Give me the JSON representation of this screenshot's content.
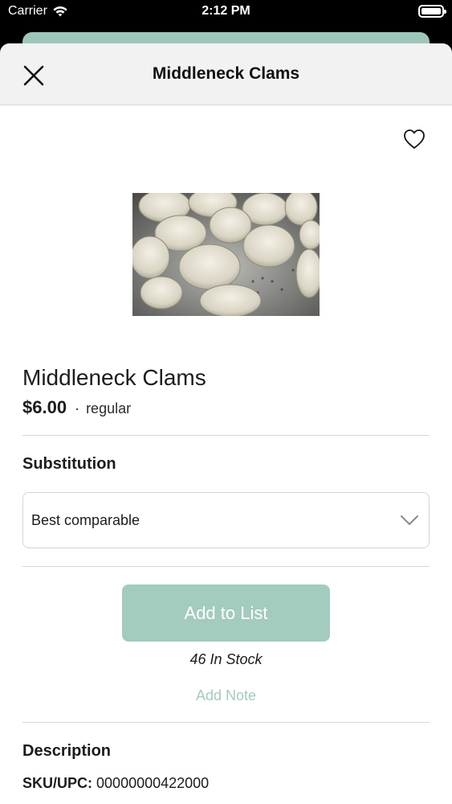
{
  "status_bar": {
    "carrier": "Carrier",
    "time": "2:12 PM"
  },
  "header": {
    "title": "Middleneck Clams"
  },
  "product": {
    "name": "Middleneck Clams",
    "price": "$6.00",
    "separator": "·",
    "price_type": "regular"
  },
  "substitution": {
    "label": "Substitution",
    "selected": "Best comparable"
  },
  "actions": {
    "add_to_list": "Add to List",
    "stock": "46 In Stock",
    "add_note": "Add Note"
  },
  "description": {
    "label": "Description",
    "sku_label": "SKU/UPC:",
    "sku_value": "00000000422000"
  },
  "colors": {
    "accent": "#a3cbbe",
    "header_bg": "#f2f2f2"
  },
  "icons": [
    "wifi-icon",
    "battery-icon",
    "close-icon",
    "heart-icon",
    "chevron-down-icon"
  ]
}
